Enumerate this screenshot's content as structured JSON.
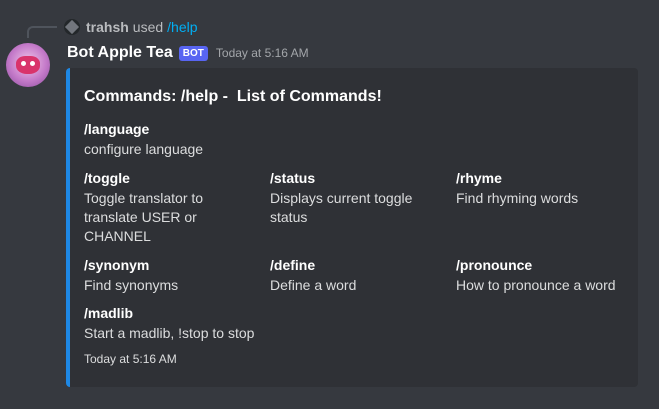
{
  "reply": {
    "username": "trahsh",
    "used_text": "used",
    "command": "/help"
  },
  "author": {
    "name": "Bot Apple Tea",
    "tag": "BOT",
    "timestamp": "Today at 5:16 AM"
  },
  "embed": {
    "title": "Commands: /help -  List of Commands!",
    "accent_color": "#1e88e5",
    "fields": [
      {
        "name": "/language",
        "value": "configure language"
      },
      {
        "name": "/toggle",
        "value": "Toggle translator to translate USER or CHANNEL"
      },
      {
        "name": "/status",
        "value": "Displays current toggle status"
      },
      {
        "name": "/rhyme",
        "value": "Find rhyming words"
      },
      {
        "name": "/synonym",
        "value": "Find synonyms"
      },
      {
        "name": "/define",
        "value": "Define a word"
      },
      {
        "name": "/pronounce",
        "value": "How to pronounce a word"
      },
      {
        "name": "/madlib",
        "value": "Start a madlib, !stop to stop"
      }
    ],
    "footer": "Today at 5:16 AM"
  },
  "colors": {
    "background": "#36393f",
    "embed_background": "#2f3136",
    "bot_tag": "#5865f2",
    "command_link": "#00aff4"
  },
  "icons": {
    "reply_avatar": "user-avatar-icon",
    "bot_avatar": "bot-avatar-icon"
  }
}
